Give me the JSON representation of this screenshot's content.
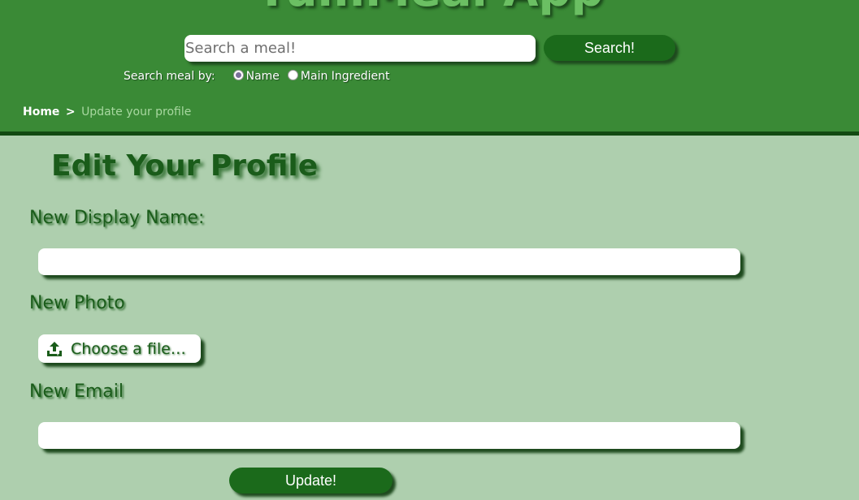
{
  "header": {
    "app_title": "YumMeal App",
    "search": {
      "placeholder": "Search a meal!",
      "value": "",
      "button_label": "Search!"
    },
    "search_by": {
      "label": "Search meal by:",
      "options": [
        {
          "label": "Name",
          "selected": true
        },
        {
          "label": "Main Ingredient",
          "selected": false
        }
      ]
    },
    "breadcrumb": {
      "home": "Home",
      "separator": ">",
      "current": "Update your profile"
    }
  },
  "form": {
    "title": "Edit Your Profile",
    "display_name": {
      "label": "New Display Name:",
      "value": ""
    },
    "photo": {
      "label": "New Photo",
      "button_label": "Choose a file…",
      "icon": "upload-icon"
    },
    "email": {
      "label": "New Email",
      "value": ""
    },
    "submit_label": "Update!"
  },
  "colors": {
    "header_bg": "#3a8a36",
    "page_bg": "#aecfae",
    "button_bg": "#1b6a1b",
    "heading_text": "#1a5c1a",
    "breadcrumb_current": "#a8d8a0"
  }
}
